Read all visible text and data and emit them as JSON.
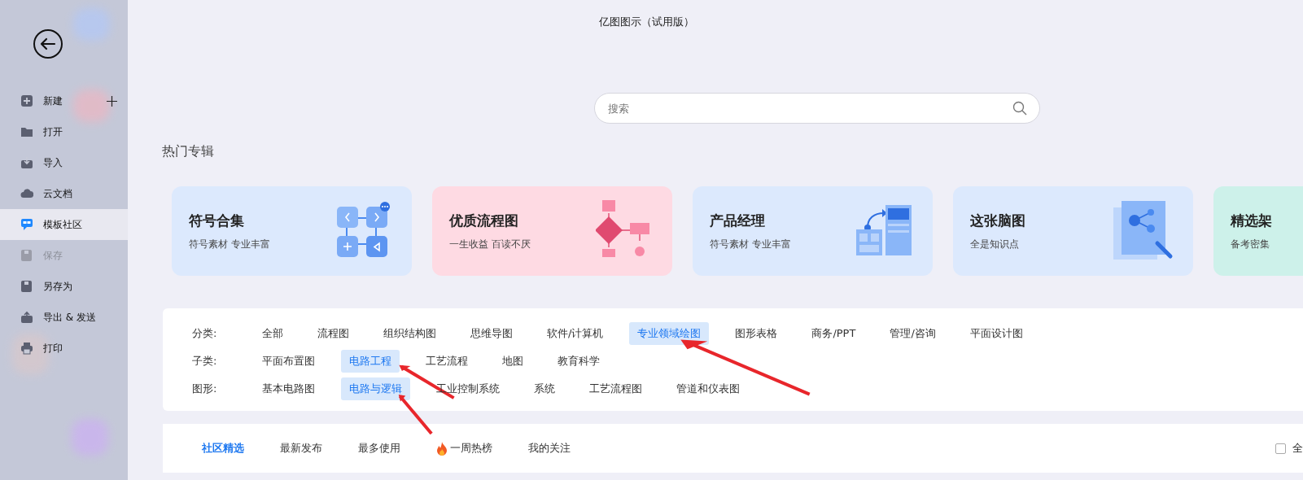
{
  "window": {
    "title": "亿图图示（试用版）"
  },
  "sidebar": {
    "items": [
      {
        "label": "新建",
        "selected": false,
        "disabled": false,
        "kind": "new"
      },
      {
        "label": "打开",
        "selected": false,
        "disabled": false,
        "kind": "plain"
      },
      {
        "label": "导入",
        "selected": false,
        "disabled": false,
        "kind": "plain"
      },
      {
        "label": "云文档",
        "selected": false,
        "disabled": false,
        "kind": "plain"
      },
      {
        "label": "模板社区",
        "selected": true,
        "disabled": false,
        "kind": "plain"
      },
      {
        "label": "保存",
        "selected": false,
        "disabled": true,
        "kind": "plain"
      },
      {
        "label": "另存为",
        "selected": false,
        "disabled": false,
        "kind": "plain"
      },
      {
        "label": "导出 & 发送",
        "selected": false,
        "disabled": false,
        "kind": "plain"
      },
      {
        "label": "打印",
        "selected": false,
        "disabled": false,
        "kind": "plain"
      }
    ]
  },
  "search": {
    "placeholder": "搜索"
  },
  "hot_section": {
    "title": "热门专辑",
    "cards": [
      {
        "title": "符号合集",
        "subtitle": "符号素材 专业丰富",
        "color": "#dce9fd"
      },
      {
        "title": "优质流程图",
        "subtitle": "一生收益 百读不厌",
        "color": "#fedae3"
      },
      {
        "title": "产品经理",
        "subtitle": "符号素材 专业丰富",
        "color": "#dce9fd"
      },
      {
        "title": "这张脑图",
        "subtitle": "全是知识点",
        "color": "#dce9fd"
      },
      {
        "title": "精选架",
        "subtitle": "备考密集",
        "color": "#cdf1ea"
      }
    ]
  },
  "filters": [
    {
      "label": "分类:",
      "options": [
        {
          "text": "全部",
          "selected": false
        },
        {
          "text": "流程图",
          "selected": false
        },
        {
          "text": "组织结构图",
          "selected": false
        },
        {
          "text": "思维导图",
          "selected": false
        },
        {
          "text": "软件/计算机",
          "selected": false
        },
        {
          "text": "专业领域绘图",
          "selected": true
        },
        {
          "text": "图形表格",
          "selected": false
        },
        {
          "text": "商务/PPT",
          "selected": false
        },
        {
          "text": "管理/咨询",
          "selected": false
        },
        {
          "text": "平面设计图",
          "selected": false
        }
      ]
    },
    {
      "label": "子类:",
      "options": [
        {
          "text": "平面布置图",
          "selected": false
        },
        {
          "text": "电路工程",
          "selected": true
        },
        {
          "text": "工艺流程",
          "selected": false
        },
        {
          "text": "地图",
          "selected": false
        },
        {
          "text": "教育科学",
          "selected": false
        }
      ]
    },
    {
      "label": "图形:",
      "options": [
        {
          "text": "基本电路图",
          "selected": false
        },
        {
          "text": "电路与逻辑",
          "selected": true
        },
        {
          "text": "工业控制系统",
          "selected": false
        },
        {
          "text": "系统",
          "selected": false
        },
        {
          "text": "工艺流程图",
          "selected": false
        },
        {
          "text": "管道和仪表图",
          "selected": false
        }
      ]
    }
  ],
  "community_tabs": [
    {
      "label": "社区精选",
      "selected": true,
      "kind": "plain"
    },
    {
      "label": "最新发布",
      "selected": false,
      "kind": "plain"
    },
    {
      "label": "最多使用",
      "selected": false,
      "kind": "plain"
    },
    {
      "label": "一周热榜",
      "selected": false,
      "kind": "hot"
    },
    {
      "label": "我的关注",
      "selected": false,
      "kind": "plain"
    }
  ],
  "select_all": {
    "label": "全",
    "checked": false
  }
}
